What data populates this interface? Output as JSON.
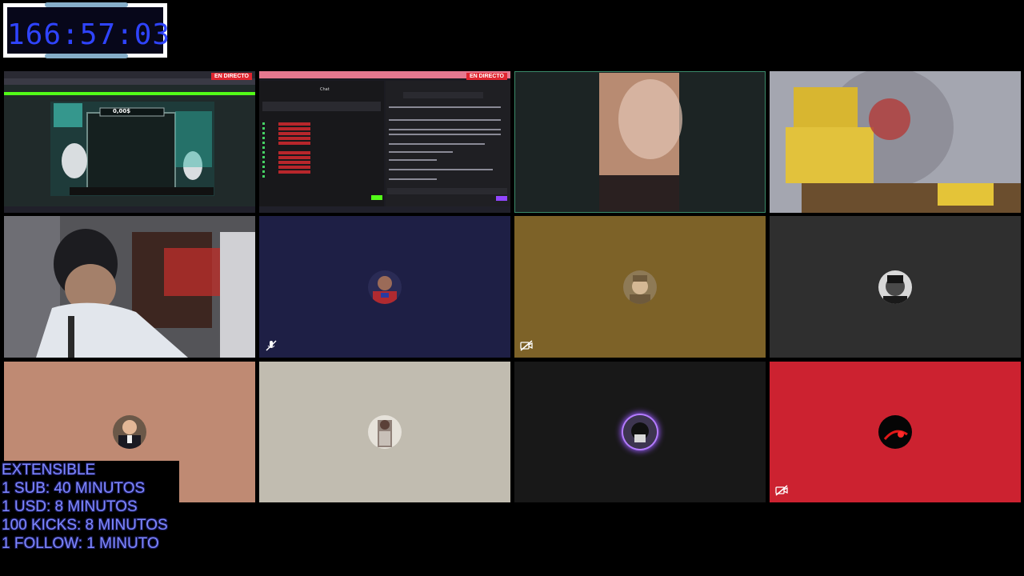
{
  "timer": {
    "value": "166:57:03"
  },
  "screens": {
    "game": {
      "live_label": "EN DIRECTO",
      "game_value": "0,00$"
    },
    "chat": {
      "live_label": "EN DIRECTO",
      "chat_title": "Chat",
      "chat_input_placeholder": "Enviar un mensaje"
    }
  },
  "participants": [
    {
      "id": "participant-1",
      "bg": "#202a2a",
      "type": "screen-share"
    },
    {
      "id": "participant-2",
      "bg": "#1b1b22",
      "type": "screen-share"
    },
    {
      "id": "participant-3",
      "bg": "#1c2424",
      "type": "camera",
      "speaking": true
    },
    {
      "id": "participant-4",
      "bg": "#9a9ca6",
      "type": "camera"
    },
    {
      "id": "participant-5",
      "bg": "#3a3a3a",
      "type": "camera"
    },
    {
      "id": "participant-6",
      "bg": "#1e1f45",
      "type": "avatar",
      "muted": true
    },
    {
      "id": "participant-7",
      "bg": "#7d6228",
      "type": "avatar",
      "camera_off": true
    },
    {
      "id": "participant-8",
      "bg": "#2f2f2f",
      "type": "avatar"
    },
    {
      "id": "participant-9",
      "bg": "#bf8a73",
      "type": "avatar"
    },
    {
      "id": "participant-10",
      "bg": "#c1bcb0",
      "type": "avatar"
    },
    {
      "id": "participant-11",
      "bg": "#181818",
      "type": "avatar",
      "speaking": true
    },
    {
      "id": "participant-12",
      "bg": "#cc2230",
      "type": "avatar",
      "camera_off": true
    }
  ],
  "rules": {
    "line1": "EXTENSIBLE",
    "line2": "1 SUB: 40 MINUTOS",
    "line3": "1 USD: 8 MINUTOS",
    "line4": "100 KICKS: 8 MINUTOS",
    "line5": "1 FOLLOW: 1 MINUTO"
  },
  "colors": {
    "accent": "#2f44ff",
    "rules_text": "#7f88ff",
    "live_badge": "#e0252f",
    "kick_green": "#53fc18"
  }
}
